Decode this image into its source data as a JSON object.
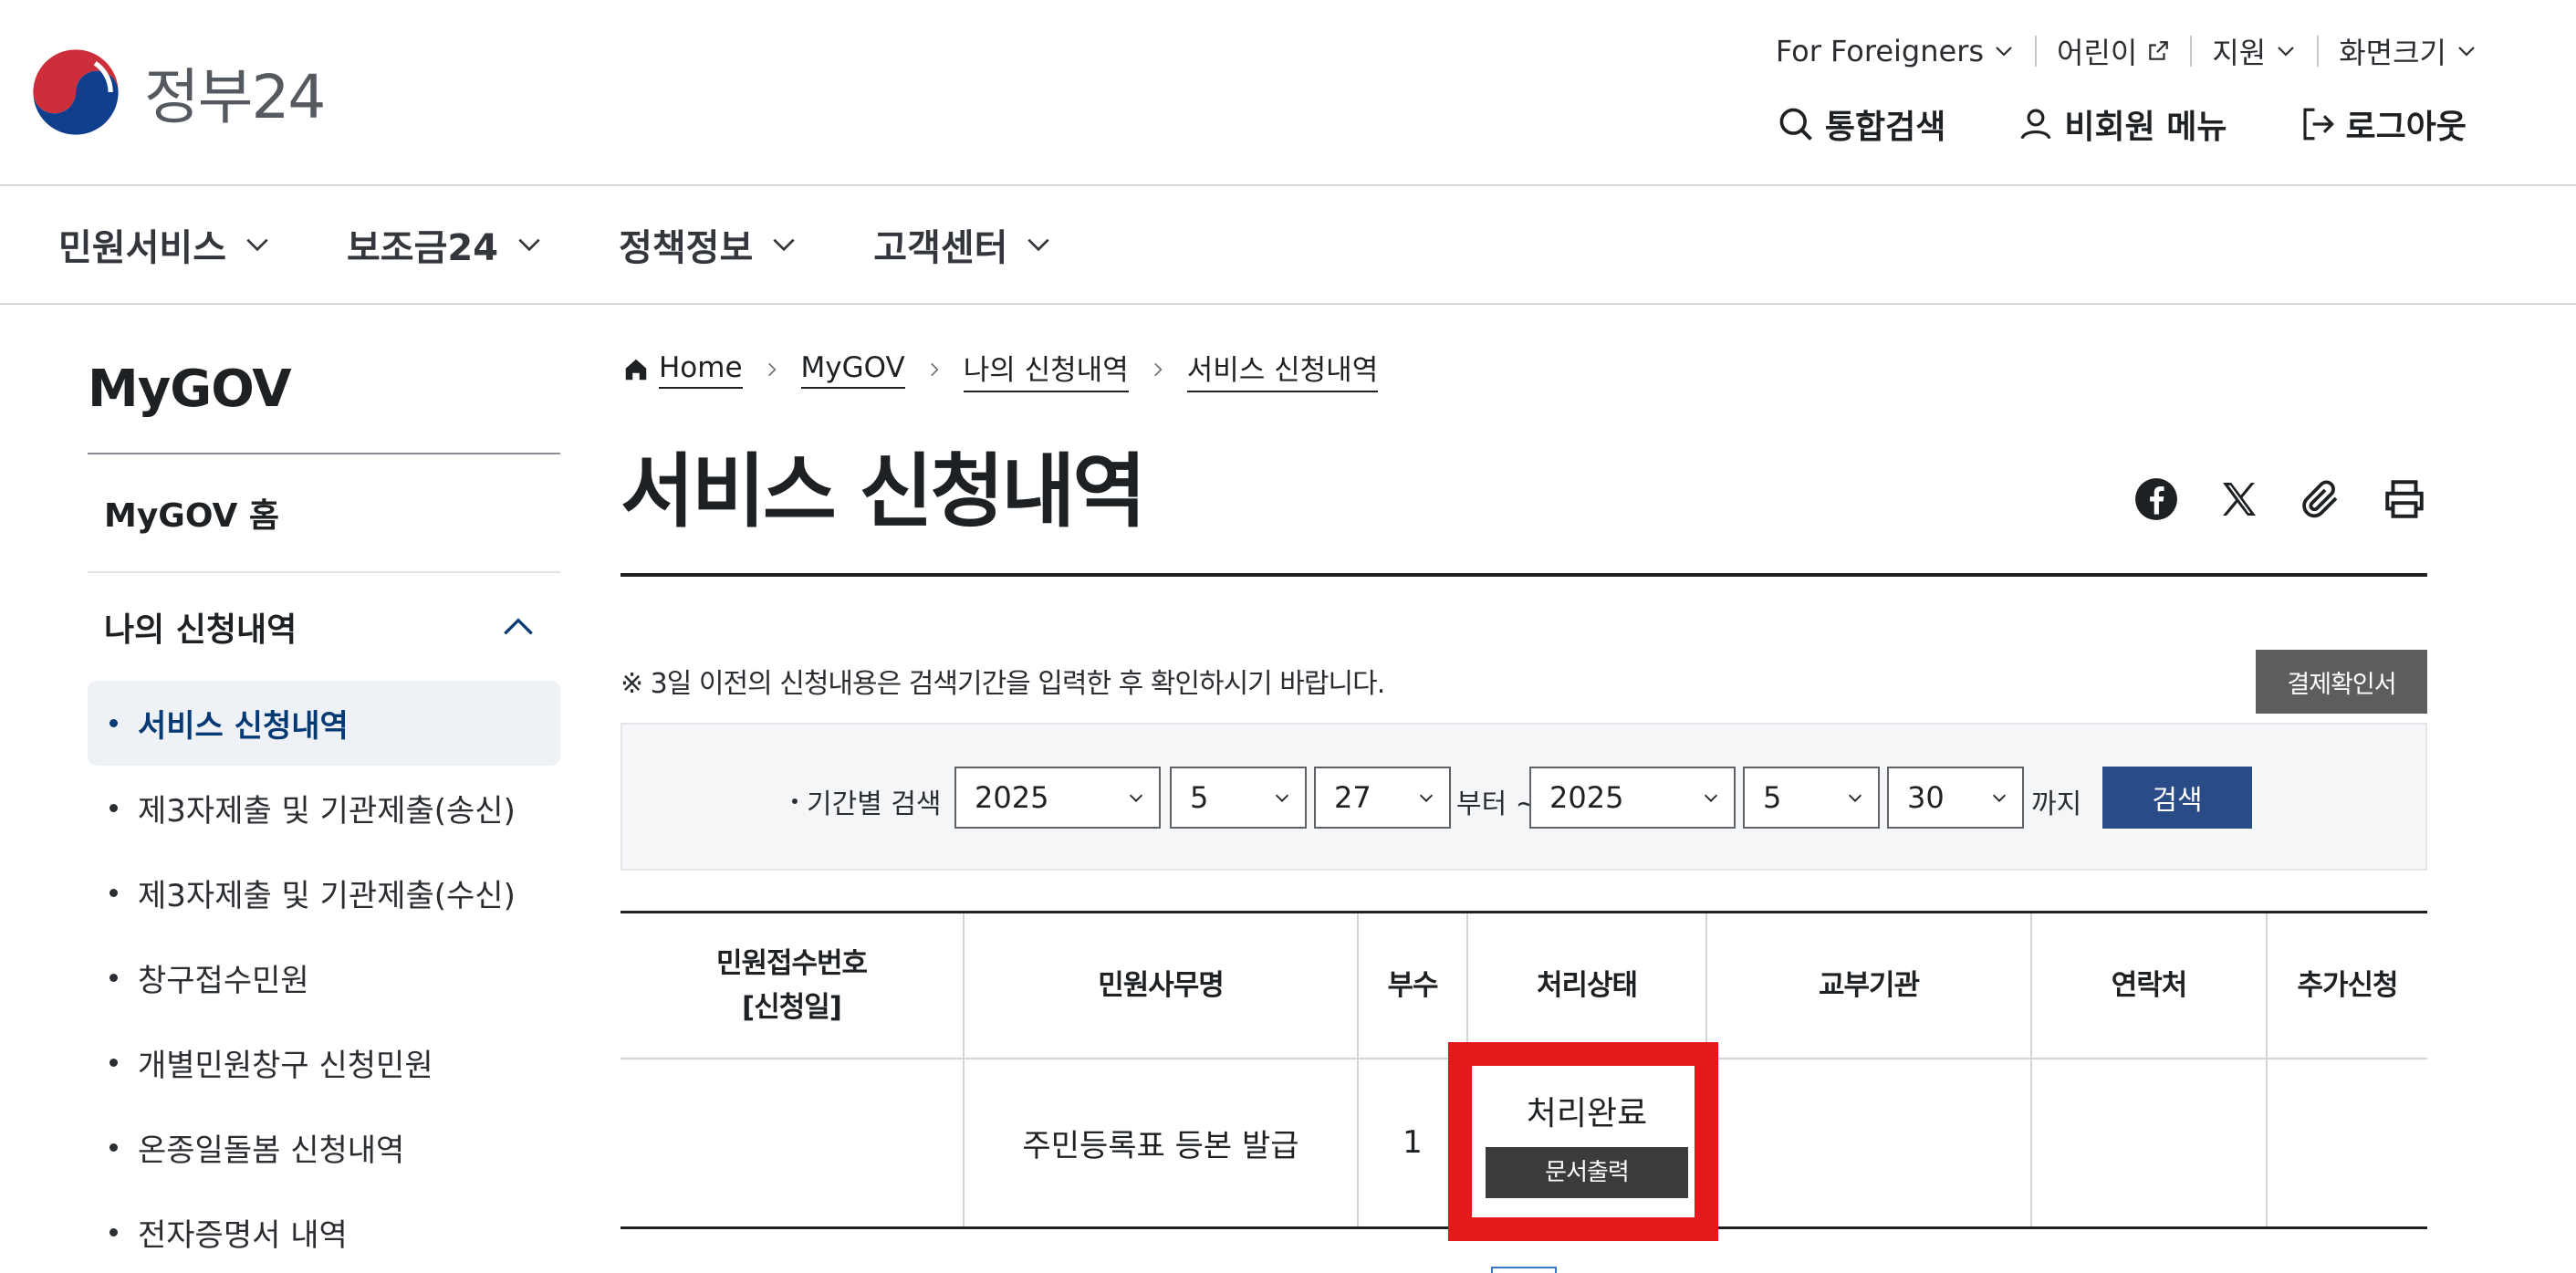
{
  "brand": {
    "name": "정부24",
    "colors": {
      "red": "#cd2e3a",
      "blue": "#0f3f8c",
      "navy": "#063a74",
      "search_button": "#2a4c86",
      "highlight": "#e3191b"
    }
  },
  "util_menu": [
    {
      "label": "For Foreigners",
      "icon": "chevron-down-icon"
    },
    {
      "label": "어린이",
      "icon": "external-link-icon"
    },
    {
      "label": "지원",
      "icon": "chevron-down-icon"
    },
    {
      "label": "화면크기",
      "icon": "chevron-down-icon"
    }
  ],
  "member_menu": {
    "search": "통합검색",
    "guest": "비회원 메뉴",
    "logout": "로그아웃"
  },
  "gnb": [
    "민원서비스",
    "보조금24",
    "정책정보",
    "고객센터"
  ],
  "sidebar": {
    "title": "MyGOV",
    "home": "MyGOV 홈",
    "group": "나의 신청내역",
    "items": [
      {
        "label": "서비스 신청내역",
        "active": true
      },
      {
        "label": "제3자제출 및 기관제출(송신)"
      },
      {
        "label": "제3자제출 및 기관제출(수신)"
      },
      {
        "label": "창구접수민원"
      },
      {
        "label": "개별민원창구 신청민원"
      },
      {
        "label": "온종일돌봄 신청내역"
      },
      {
        "label": "전자증명서 내역"
      }
    ]
  },
  "breadcrumb": [
    "Home",
    "MyGOV",
    "나의 신청내역",
    "서비스 신청내역"
  ],
  "page": {
    "title": "서비스 신청내역",
    "share_icons": [
      "facebook-icon",
      "x-twitter-icon",
      "paperclip-icon",
      "printer-icon"
    ]
  },
  "notice": "※ 3일 이전의 신청내용은 검색기간을 입력한 후 확인하시기 바랍니다.",
  "receipt_button": "결제확인서",
  "search": {
    "label": "기간별 검색",
    "from": {
      "year": "2025",
      "month": "5",
      "day": "27"
    },
    "from_suffix": "부터 ~",
    "to": {
      "year": "2025",
      "month": "5",
      "day": "30"
    },
    "to_suffix": "까지",
    "button": "검색"
  },
  "table": {
    "headers": [
      "민원접수번호",
      "[신청일]",
      "민원사무명",
      "부수",
      "처리상태",
      "교부기관",
      "연락처",
      "추가신청"
    ],
    "row": {
      "receipt_no": "",
      "service": "주민등록표 등본 발급",
      "copies": "1",
      "status": "처리완료",
      "print_button": "문서출력",
      "agency": "",
      "contact": "",
      "extra": ""
    }
  }
}
